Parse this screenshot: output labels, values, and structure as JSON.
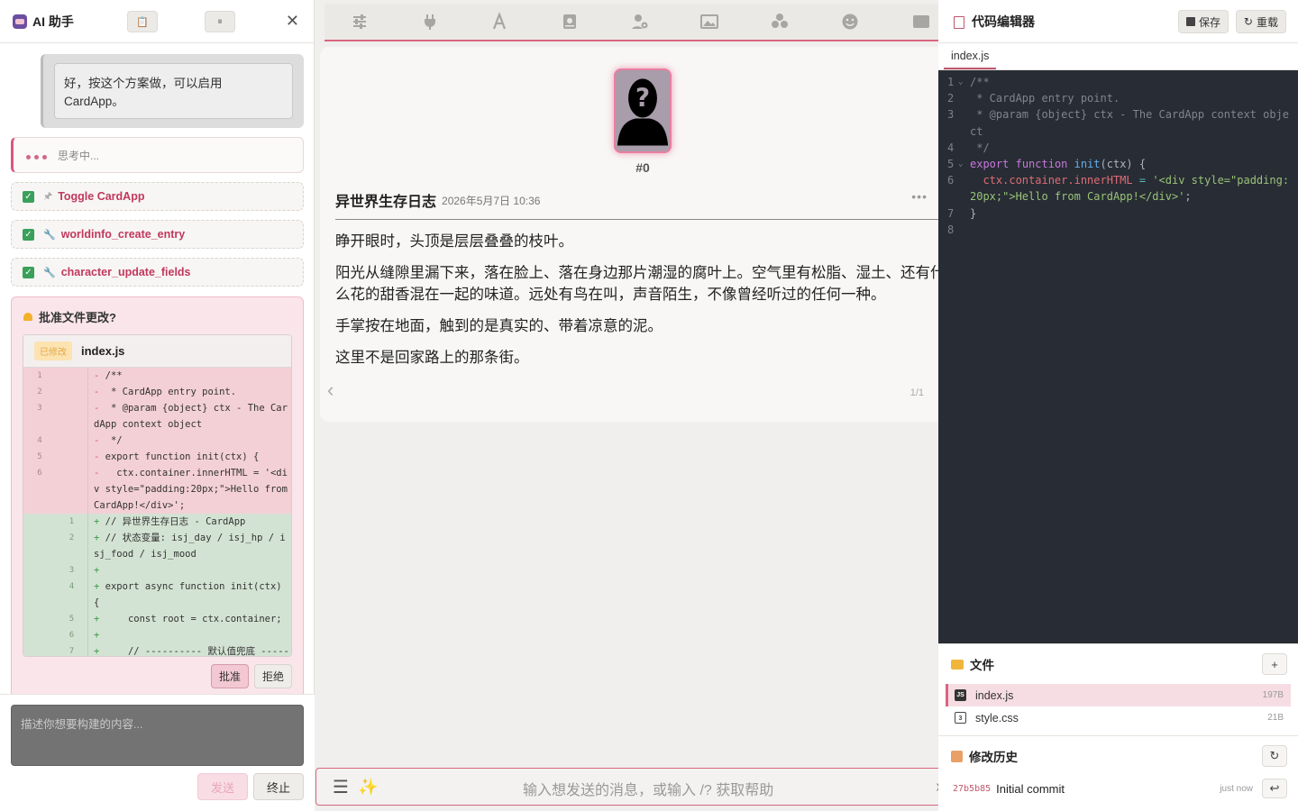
{
  "left": {
    "title": "AI 助手",
    "user_message": "好，按这个方案做，可以启用 CardApp。",
    "thinking": "思考中...",
    "tools": [
      {
        "name": "Toggle CardApp"
      },
      {
        "name": "worldinfo_create_entry"
      },
      {
        "name": "character_update_fields"
      }
    ],
    "approval": {
      "title": "批准文件更改?",
      "badge": "已修改",
      "file": "index.js",
      "deleted": [
        {
          "n": "1",
          "code": "/**"
        },
        {
          "n": "2",
          "code": " * CardApp entry point."
        },
        {
          "n": "3",
          "code": " * @param {object} ctx - The CardApp context object"
        },
        {
          "n": "4",
          "code": " */"
        },
        {
          "n": "5",
          "code": "export function init(ctx) {"
        },
        {
          "n": "6",
          "code": "  ctx.container.innerHTML = '<div style=\"padding:20px;\">Hello from CardApp!</div>';"
        }
      ],
      "added": [
        {
          "n": "1",
          "code": "// 异世界生存日志 - CardApp"
        },
        {
          "n": "2",
          "code": "// 状态变量: isj_day / isj_hp / isj_food / isj_mood"
        },
        {
          "n": "3",
          "code": ""
        },
        {
          "n": "4",
          "code": "export async function init(ctx) {"
        },
        {
          "n": "5",
          "code": "    const root = ctx.container;"
        },
        {
          "n": "6",
          "code": ""
        },
        {
          "n": "7",
          "code": "    // ---------- 默认值兜底 ----------"
        }
      ],
      "approve_label": "批准",
      "reject_label": "拒绝"
    },
    "prompt_placeholder": "描述你想要构建的内容...",
    "send_label": "发送",
    "stop_label": "终止"
  },
  "center": {
    "mesid": "#0",
    "char_name": "异世界生存日志",
    "timestamp": "2026年5月7日 10:36",
    "paragraphs": [
      "睁开眼时，头顶是层层叠叠的枝叶。",
      "阳光从缝隙里漏下来，落在脸上、落在身边那片潮湿的腐叶上。空气里有松脂、湿土、还有什么花的甜香混在一起的味道。远处有鸟在叫，声音陌生，不像曾经听过的任何一种。",
      "手掌按在地面，触到的是真实的、带着凉意的泥。",
      "这里不是回家路上的那条街。"
    ],
    "swipe_counter": "1/1",
    "input_placeholder": "输入想发送的消息，或输入 /? 获取帮助"
  },
  "right": {
    "title": "代码编辑器",
    "save_label": "保存",
    "reload_label": "重载",
    "active_tab": "index.js",
    "files_title": "文件",
    "files": [
      {
        "name": "index.js",
        "size": "197B",
        "type": "JS"
      },
      {
        "name": "style.css",
        "size": "21B",
        "type": "css"
      }
    ],
    "history_title": "修改历史",
    "commits": [
      {
        "hash": "27b5b85",
        "message": "Initial commit",
        "time": "just now"
      }
    ]
  },
  "colors": {
    "accent": "#d9657f",
    "editor_bg": "#282c34",
    "diff_del": "#f3d0d5",
    "diff_add": "#d3e3d3"
  }
}
